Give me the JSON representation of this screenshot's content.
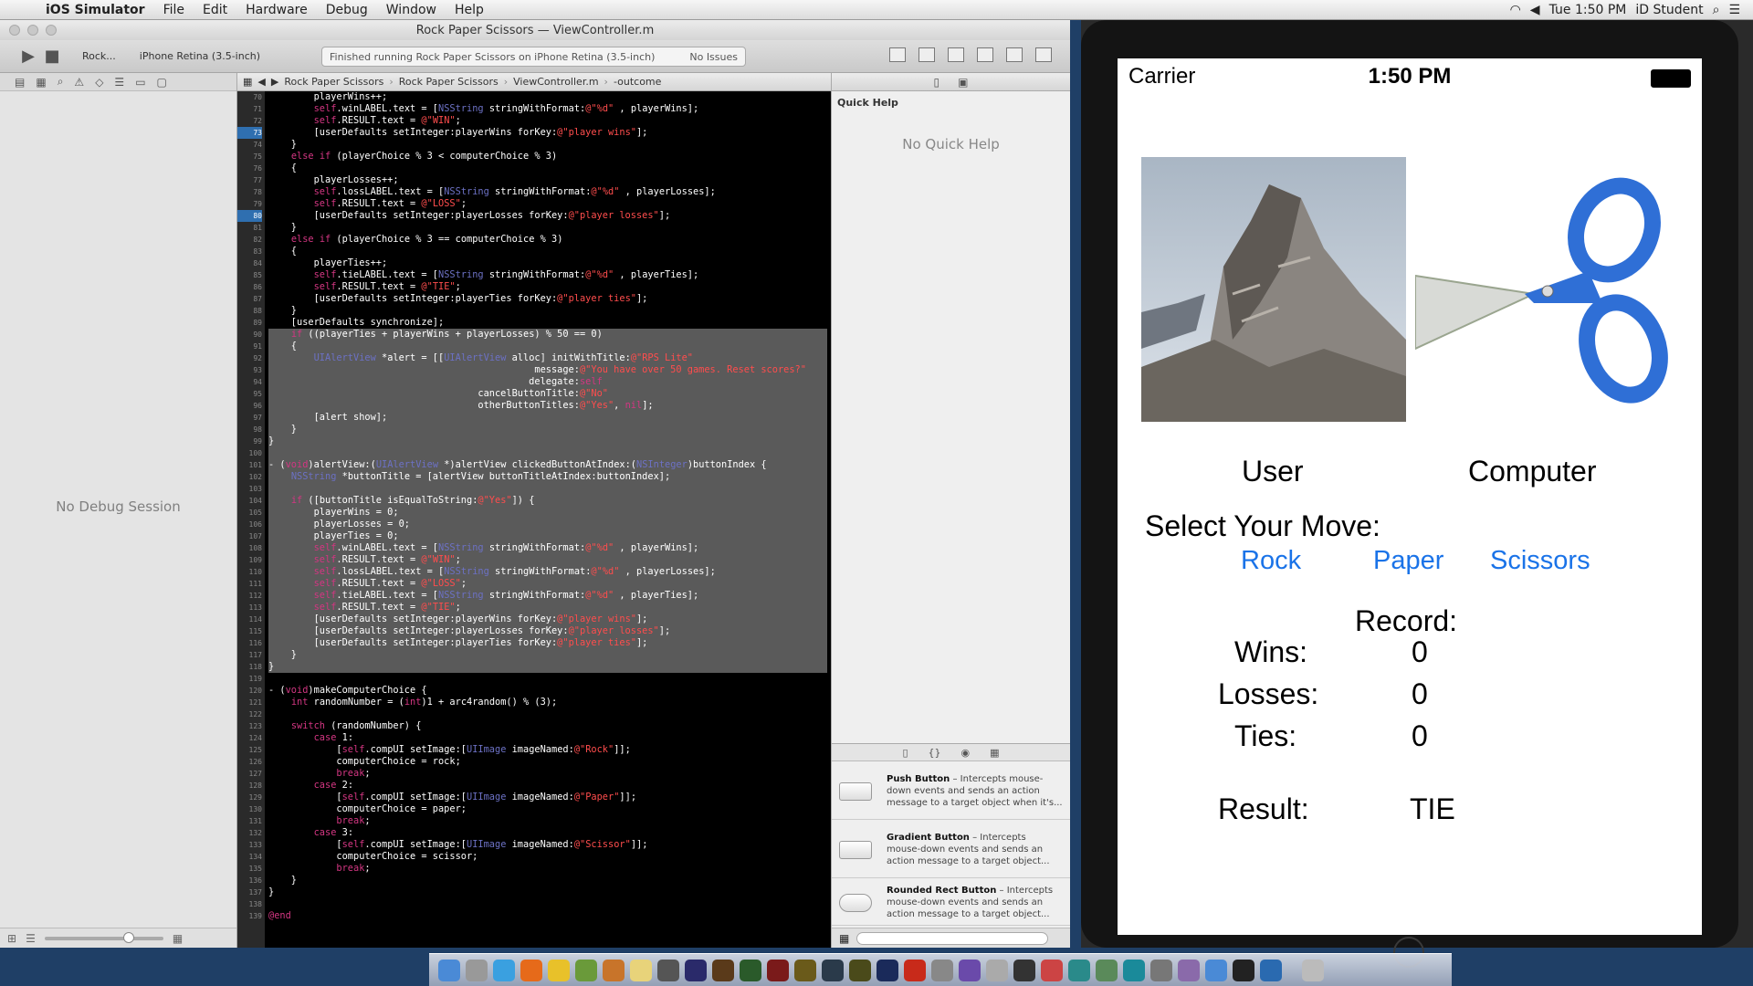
{
  "menubar": {
    "app": "iOS Simulator",
    "items": [
      "File",
      "Edit",
      "Hardware",
      "Debug",
      "Window",
      "Help"
    ],
    "time": "Tue 1:50 PM",
    "user": "iD Student"
  },
  "xcode": {
    "title_project": "Rock Paper Scissors",
    "title_sep": "—",
    "title_file": "ViewController.m",
    "scheme": "Rock...",
    "device": "iPhone Retina (3.5-inch)",
    "status": "Finished running Rock Paper Scissors on iPhone Retina (3.5-inch)",
    "issues": "No Issues",
    "jumpbar": [
      "Rock Paper Scissors",
      "Rock Paper Scissors",
      "ViewController.m",
      "-outcome"
    ],
    "no_debug": "No Debug Session",
    "quick_help_title": "Quick Help",
    "no_quick_help": "No Quick Help",
    "library": [
      {
        "name": "Push Button",
        "desc": "– Intercepts mouse-down events and sends an action message to a target object when it's..."
      },
      {
        "name": "Gradient Button",
        "desc": "– Intercepts mouse-down events and sends an action message to a target object..."
      },
      {
        "name": "Rounded Rect Button",
        "desc": "– Intercepts mouse-down events and sends an action message to a target object..."
      }
    ]
  },
  "code": {
    "first_line_number": 70,
    "breakpoints": [
      73,
      80
    ],
    "highlight_start": 90,
    "highlight_end": 118,
    "lines": [
      "        playerWins++;",
      "        self.winLABEL.text = [NSString stringWithFormat:@\"%d\" , playerWins];",
      "        self.RESULT.text = @\"WIN\";",
      "        [userDefaults setInteger:playerWins forKey:@\"player wins\"];",
      "    }",
      "    else if (playerChoice % 3 < computerChoice % 3)",
      "    {",
      "        playerLosses++;",
      "        self.lossLABEL.text = [NSString stringWithFormat:@\"%d\" , playerLosses];",
      "        self.RESULT.text = @\"LOSS\";",
      "        [userDefaults setInteger:playerLosses forKey:@\"player losses\"];",
      "    }",
      "    else if (playerChoice % 3 == computerChoice % 3)",
      "    {",
      "        playerTies++;",
      "        self.tieLABEL.text = [NSString stringWithFormat:@\"%d\" , playerTies];",
      "        self.RESULT.text = @\"TIE\";",
      "        [userDefaults setInteger:playerTies forKey:@\"player ties\"];",
      "    }",
      "    [userDefaults synchronize];",
      "    if ((playerTies + playerWins + playerLosses) % 50 == 0)",
      "    {",
      "        UIAlertView *alert = [[UIAlertView alloc] initWithTitle:@\"RPS Lite\"",
      "                                               message:@\"You have over 50 games. Reset scores?\"",
      "                                              delegate:self",
      "                                     cancelButtonTitle:@\"No\"",
      "                                     otherButtonTitles:@\"Yes\", nil];",
      "        [alert show];",
      "    }",
      "}",
      "",
      "- (void)alertView:(UIAlertView *)alertView clickedButtonAtIndex:(NSInteger)buttonIndex {",
      "    NSString *buttonTitle = [alertView buttonTitleAtIndex:buttonIndex];",
      "",
      "    if ([buttonTitle isEqualToString:@\"Yes\"]) {",
      "        playerWins = 0;",
      "        playerLosses = 0;",
      "        playerTies = 0;",
      "        self.winLABEL.text = [NSString stringWithFormat:@\"%d\" , playerWins];",
      "        self.RESULT.text = @\"WIN\";",
      "        self.lossLABEL.text = [NSString stringWithFormat:@\"%d\" , playerLosses];",
      "        self.RESULT.text = @\"LOSS\";",
      "        self.tieLABEL.text = [NSString stringWithFormat:@\"%d\" , playerTies];",
      "        self.RESULT.text = @\"TIE\";",
      "        [userDefaults setInteger:playerWins forKey:@\"player wins\"];",
      "        [userDefaults setInteger:playerLosses forKey:@\"player losses\"];",
      "        [userDefaults setInteger:playerTies forKey:@\"player ties\"];",
      "    }",
      "}",
      "",
      "- (void)makeComputerChoice {",
      "    int randomNumber = (int)1 + arc4random() % (3);",
      "",
      "    switch (randomNumber) {",
      "        case 1:",
      "            [self.compUI setImage:[UIImage imageNamed:@\"Rock\"]];",
      "            computerChoice = rock;",
      "            break;",
      "        case 2:",
      "            [self.compUI setImage:[UIImage imageNamed:@\"Paper\"]];",
      "            computerChoice = paper;",
      "            break;",
      "        case 3:",
      "            [self.compUI setImage:[UIImage imageNamed:@\"Scissor\"]];",
      "            computerChoice = scissor;",
      "            break;",
      "    }",
      "}",
      "",
      "@end"
    ]
  },
  "phone": {
    "carrier": "Carrier",
    "time": "1:50 PM",
    "user_label": "User",
    "computer_label": "Computer",
    "select_move": "Select Your Move:",
    "moves": [
      "Rock",
      "Paper",
      "Scissors"
    ],
    "record_label": "Record:",
    "wins_label": "Wins:",
    "wins": "0",
    "losses_label": "Losses:",
    "losses": "0",
    "ties_label": "Ties:",
    "ties": "0",
    "result_label": "Result:",
    "result": "TIE",
    "colors": {
      "button_blue": "#1a73e8",
      "scissor_blue": "#2f6fd6"
    }
  }
}
